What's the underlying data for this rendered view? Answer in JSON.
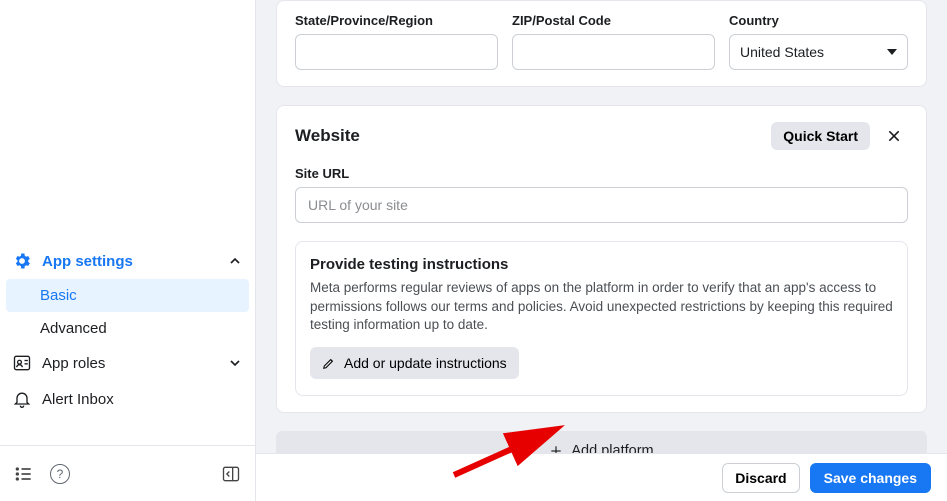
{
  "sidebar": {
    "app_settings": {
      "label": "App settings"
    },
    "items": [
      {
        "label": "Basic",
        "active": true
      },
      {
        "label": "Advanced",
        "active": false
      }
    ],
    "app_roles": {
      "label": "App roles"
    },
    "alert_inbox": {
      "label": "Alert Inbox"
    }
  },
  "address": {
    "state_label": "State/Province/Region",
    "state_value": "",
    "zip_label": "ZIP/Postal Code",
    "zip_value": "",
    "country_label": "Country",
    "country_value": "United States"
  },
  "website": {
    "title": "Website",
    "quick_start_label": "Quick Start",
    "site_url_label": "Site URL",
    "site_url_placeholder": "URL of your site",
    "site_url_value": "",
    "testing": {
      "title": "Provide testing instructions",
      "desc": "Meta performs regular reviews of apps on the platform in order to verify that an app's access to permissions follows our terms and policies. Avoid unexpected restrictions by keeping this required testing information up to date.",
      "button": "Add or update instructions"
    }
  },
  "add_platform_label": "Add platform",
  "footer": {
    "discard_label": "Discard",
    "save_label": "Save changes"
  },
  "colors": {
    "accent": "#1877f2"
  }
}
